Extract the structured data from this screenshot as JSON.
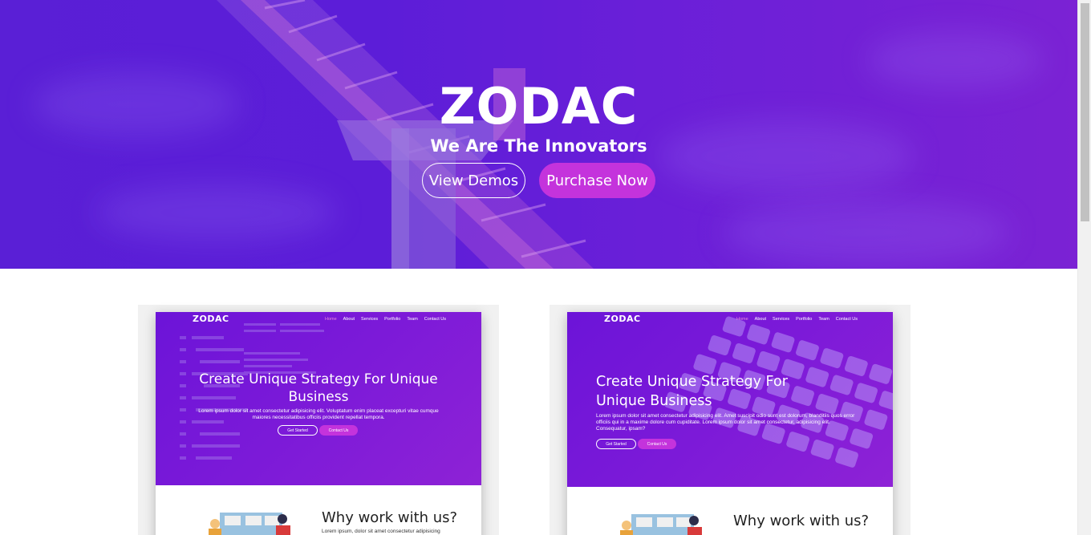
{
  "hero": {
    "title": "ZODAC",
    "subtitle": "We Are The Innovators",
    "view_demos_label": "View Demos",
    "purchase_label": "Purchase Now"
  },
  "demos": [
    {
      "logo": "ZODAC",
      "menu": [
        "Home",
        "About",
        "Services",
        "Portfolio",
        "Team",
        "Contact Us"
      ],
      "active_menu": "Home",
      "headline": "Create Unique Strategy For Unique Business",
      "paragraph": "Lorem ipsum dolor sit amet consectetur adipisicing elit. Voluptatum enim placeat excepturi vitae cumque maiores necessitatibus officiis provident repellat tempora.",
      "get_started_label": "Get Started",
      "contact_label": "Contact Us",
      "section_title": "Why work with us?",
      "section_text": "Lorem ipsum, dolor sit amet consectetur adipisicing"
    },
    {
      "logo": "ZODAC",
      "menu": [
        "Home",
        "About",
        "Services",
        "Portfolio",
        "Team",
        "Contact Us"
      ],
      "active_menu": "Home",
      "headline": "Create Unique Strategy For Unique Business",
      "paragraph": "Lorem ipsum dolor sit amet consectetur adipisicing elit. Amet suscipit odio sunt est dolorum, blanditiis quos error officiis qui in a maxime dolore cum cupiditate. Lorem ipsum dolor sit amet consectetur, adipisicing elit. Consequatur, ipsam?",
      "get_started_label": "Get Started",
      "contact_label": "Contact Us",
      "section_title": "Why work with us?",
      "section_text": ""
    }
  ],
  "colors": {
    "hero_gradient_start": "#5a1fd6",
    "hero_gradient_end": "#7b22d4",
    "accent": "#c433dc",
    "card_bg": "#f1f1f1"
  }
}
